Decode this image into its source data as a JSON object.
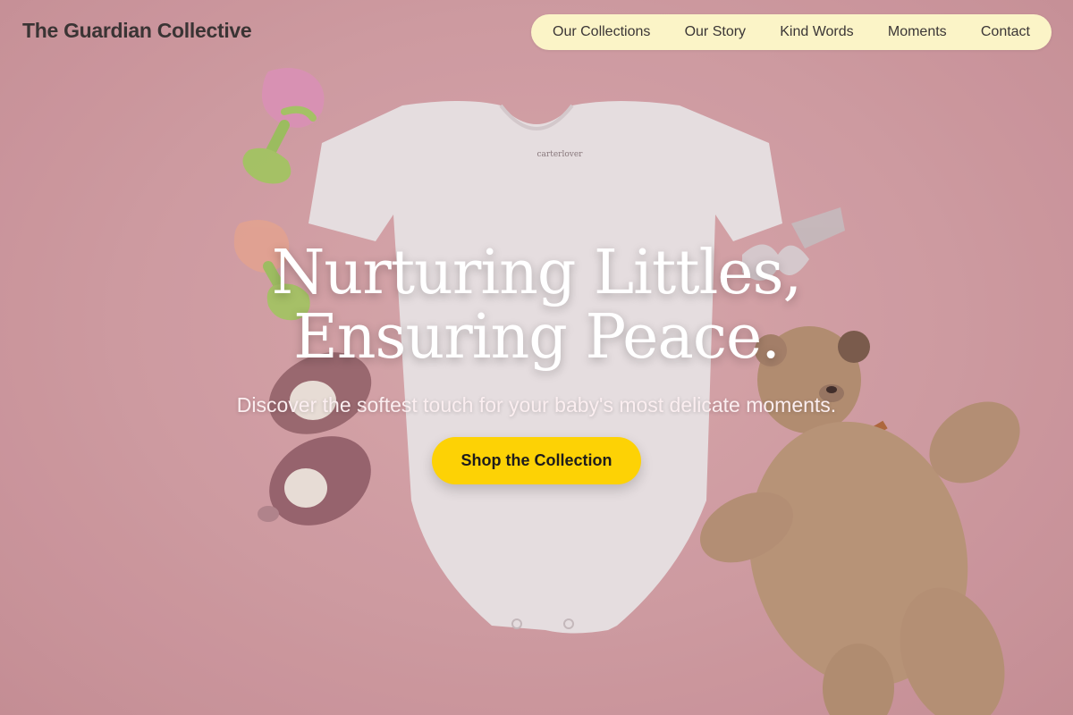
{
  "brand": {
    "name": "The Guardian Collective"
  },
  "nav": {
    "items": [
      {
        "label": "Our Collections"
      },
      {
        "label": "Our Story"
      },
      {
        "label": "Kind Words"
      },
      {
        "label": "Moments"
      },
      {
        "label": "Contact"
      }
    ]
  },
  "hero": {
    "headline_line1": "Nurturing Littles,",
    "headline_line2": "Ensuring Peace.",
    "subheadline": "Discover the softest touch for your baby's most delicate moments.",
    "cta_label": "Shop the Collection",
    "background_image_label": "carterlover"
  },
  "colors": {
    "nav_background": "#fbf4c7",
    "cta_background": "#fdd205",
    "hero_background": "#dba8ad",
    "headline": "#ffffff"
  }
}
